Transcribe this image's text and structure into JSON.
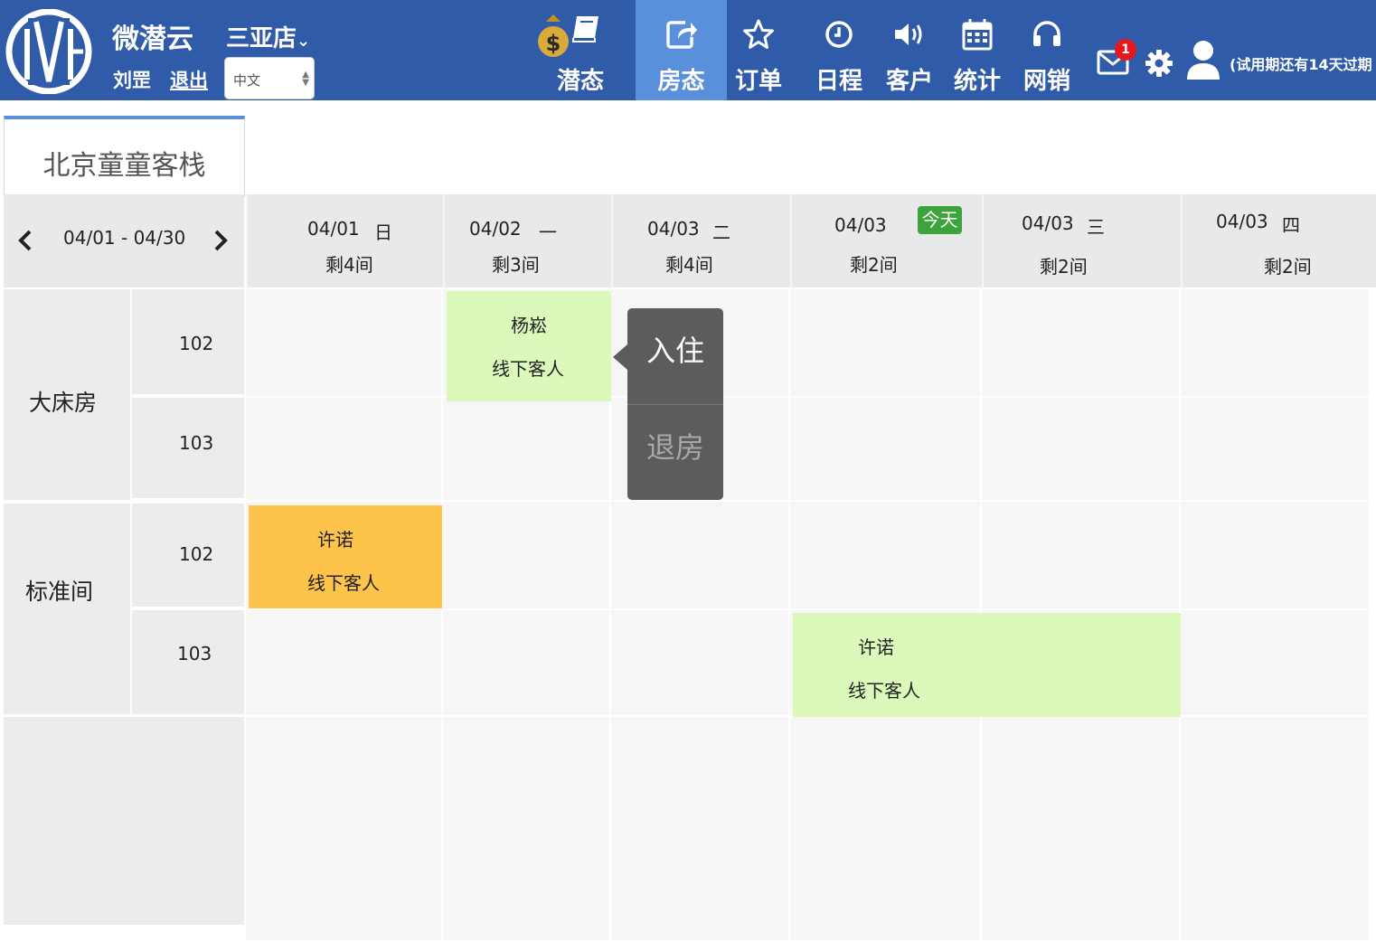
{
  "header": {
    "brand": "微潜云",
    "store": "三亚店",
    "user_name": "刘罡",
    "logout_label": "退出",
    "language_selected": "中文",
    "nav": [
      {
        "label": "潜态",
        "icon": "money-bag-book-icon",
        "active": false
      },
      {
        "label": "房态",
        "icon": "share-icon",
        "active": true
      },
      {
        "label": "订单",
        "icon": "star-icon",
        "active": false
      },
      {
        "label": "日程",
        "icon": "clock-icon",
        "active": false
      },
      {
        "label": "客户",
        "icon": "speaker-icon",
        "active": false
      },
      {
        "label": "统计",
        "icon": "calendar-icon",
        "active": false
      },
      {
        "label": "网销",
        "icon": "headphones-icon",
        "active": false
      }
    ],
    "mail_badge": "1",
    "trial_notice": "(试用期还有14天过期"
  },
  "hotel_tab": "北京童童客栈",
  "calendar": {
    "range": "04/01 - 04/30",
    "days": [
      {
        "date": "04/01",
        "weekday": "日",
        "remaining": "剩4间"
      },
      {
        "date": "04/02",
        "weekday": "一",
        "remaining": "剩3间"
      },
      {
        "date": "04/03",
        "weekday": "二",
        "remaining": "剩4间"
      },
      {
        "date": "04/03",
        "weekday": "",
        "remaining": "剩2间",
        "today_label": "今天"
      },
      {
        "date": "04/03",
        "weekday": "三",
        "remaining": "剩2间"
      },
      {
        "date": "04/03",
        "weekday": "四",
        "remaining": "剩2间"
      }
    ],
    "room_types": [
      {
        "name": "大床房",
        "rooms": [
          "102",
          "103"
        ]
      },
      {
        "name": "标准间",
        "rooms": [
          "102",
          "103"
        ]
      }
    ],
    "bookings": [
      {
        "guest": "杨崧",
        "source": "线下客人",
        "color": "#dcf8bb"
      },
      {
        "guest": "许诺",
        "source": "线下客人",
        "color": "#fdc34a"
      },
      {
        "guest": "许诺",
        "source": "线下客人",
        "color": "#dcf8bb"
      }
    ]
  },
  "popup": {
    "checkin_label": "入住",
    "checkout_label": "退房"
  }
}
